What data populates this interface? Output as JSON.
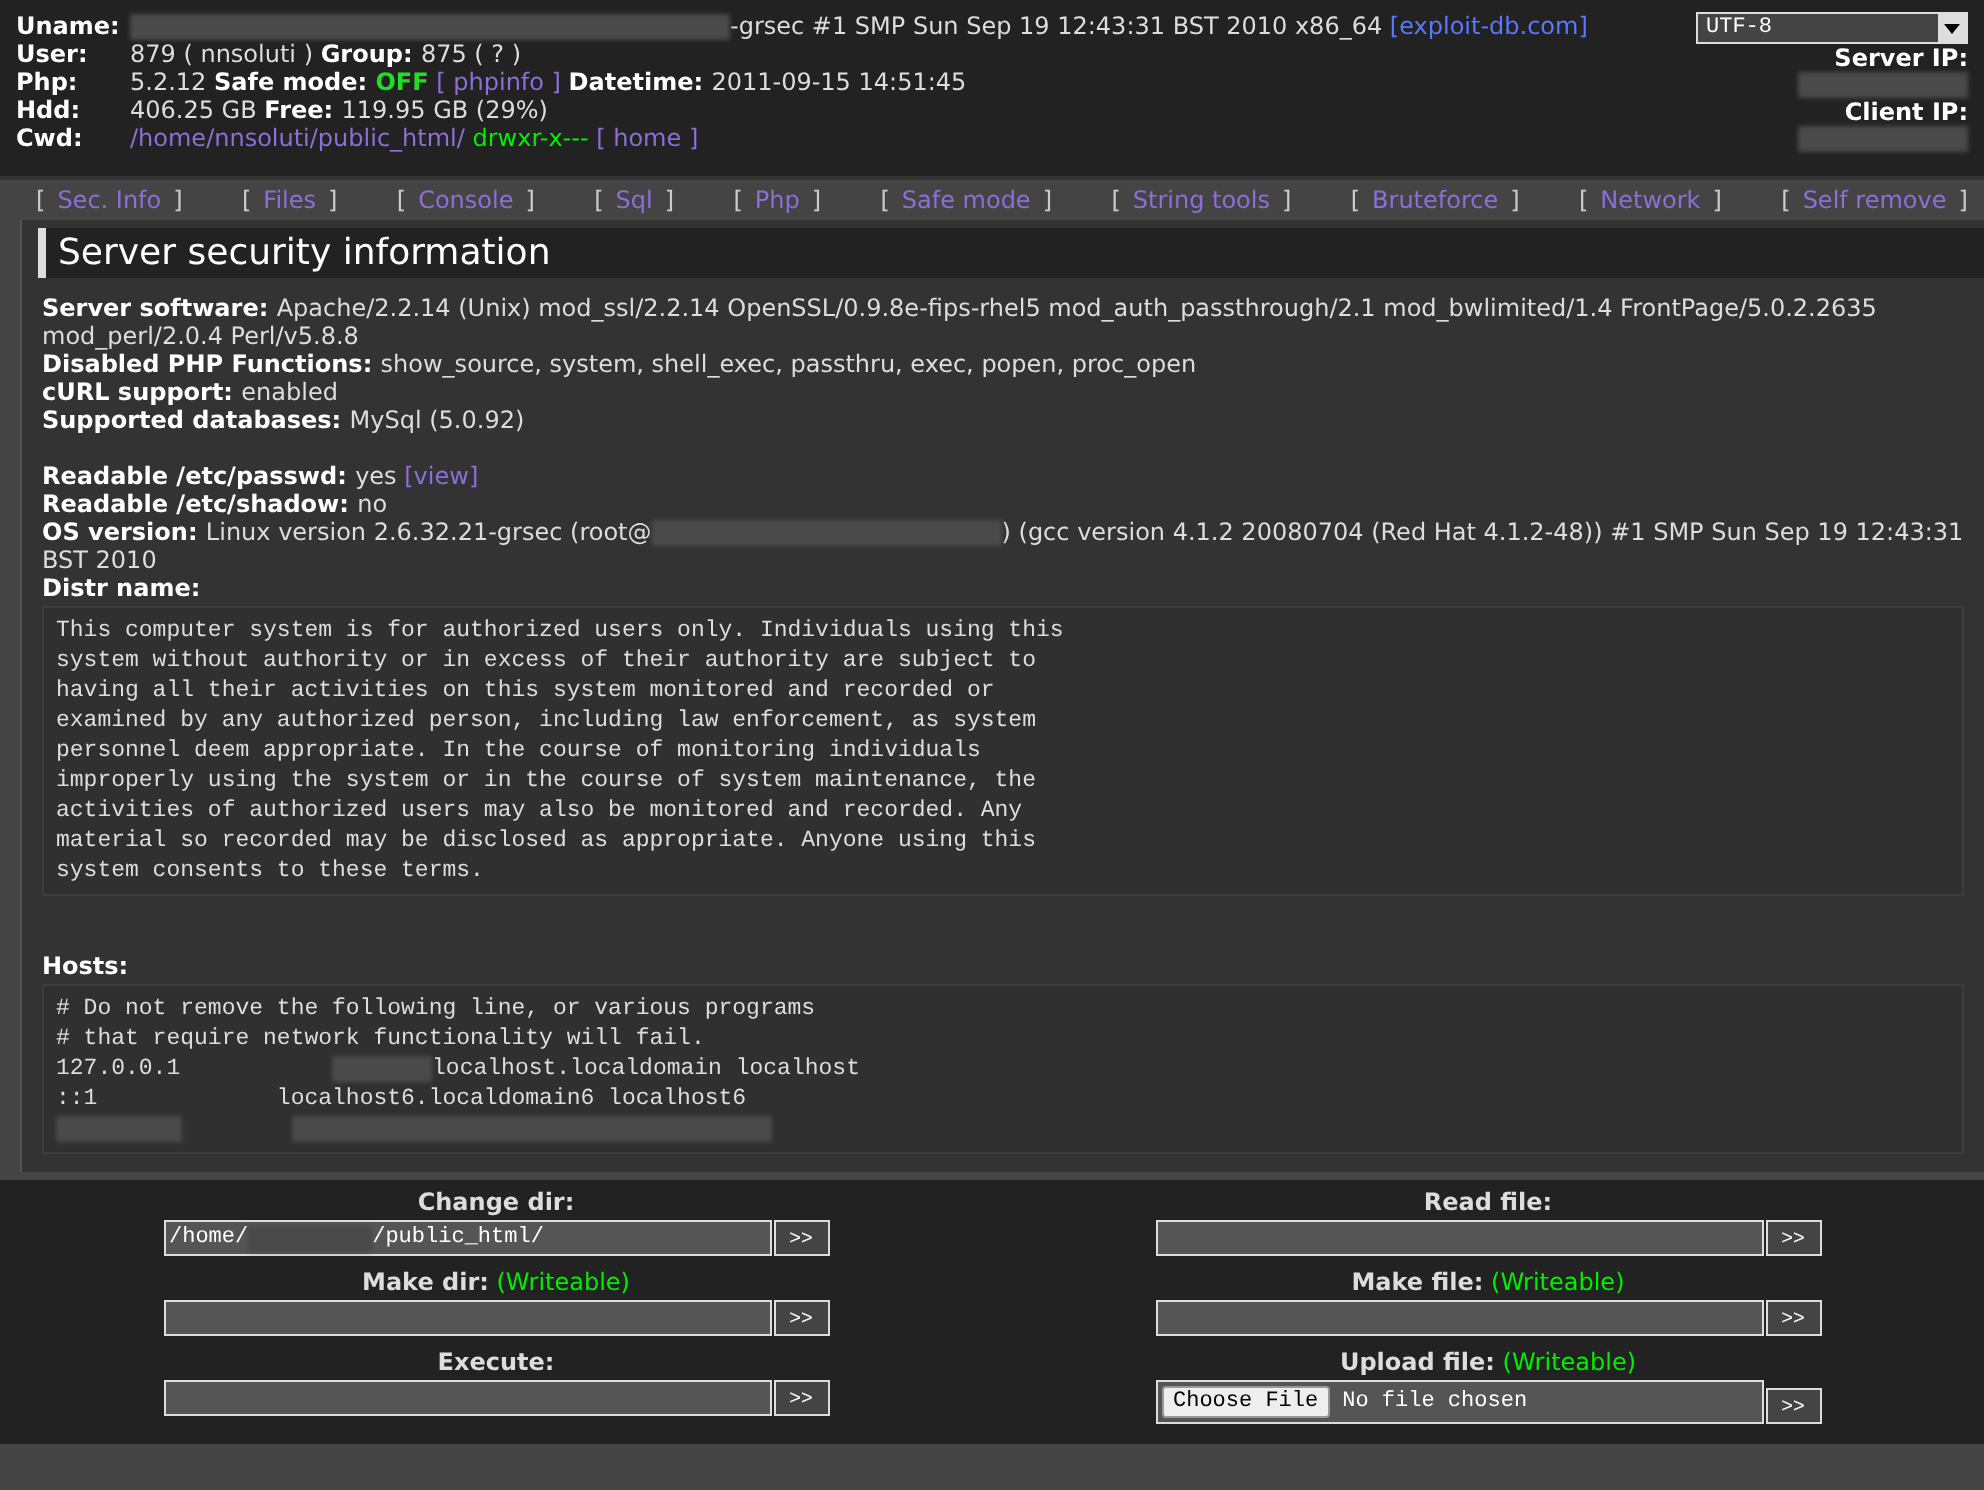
{
  "header": {
    "rows": [
      {
        "label": "Uname:",
        "parts": [
          {
            "kind": "redacted"
          },
          {
            "kind": "text",
            "text": "-grsec #1 SMP Sun Sep 19 12:43:31 BST 2010 x86_64 "
          },
          {
            "kind": "blue_link",
            "text": "[exploit-db.com]"
          }
        ]
      },
      {
        "label": "User:",
        "parts": [
          {
            "kind": "text",
            "text": "879 ( nnsoluti ) "
          },
          {
            "kind": "bold",
            "text": "Group: "
          },
          {
            "kind": "text",
            "text": "875 ( ? )"
          }
        ]
      },
      {
        "label": "Php:",
        "parts": [
          {
            "kind": "text",
            "text": "5.2.12 "
          },
          {
            "kind": "bold",
            "text": "Safe mode: "
          },
          {
            "kind": "green_bold",
            "text": "OFF"
          },
          {
            "kind": "link",
            "text": " [ phpinfo ] "
          },
          {
            "kind": "bold",
            "text": "Datetime: "
          },
          {
            "kind": "text",
            "text": "2011-09-15 14:51:45"
          }
        ]
      },
      {
        "label": "Hdd:",
        "parts": [
          {
            "kind": "text",
            "text": "406.25 GB "
          },
          {
            "kind": "bold",
            "text": "Free: "
          },
          {
            "kind": "text",
            "text": "119.95 GB (29%)"
          }
        ]
      },
      {
        "label": "Cwd:",
        "parts": [
          {
            "kind": "link",
            "text": "/home/nnsoluti/public_html/ "
          },
          {
            "kind": "green",
            "text": "drwxr-x---"
          },
          {
            "kind": "link",
            "text": " [ home ]"
          }
        ]
      }
    ],
    "charset": "UTF-8",
    "server_ip_label": "Server IP:",
    "client_ip_label": "Client IP:"
  },
  "nav": [
    {
      "label": "Sec. Info"
    },
    {
      "label": "Files"
    },
    {
      "label": "Console"
    },
    {
      "label": "Sql"
    },
    {
      "label": "Php"
    },
    {
      "label": "Safe mode"
    },
    {
      "label": "String tools"
    },
    {
      "label": "Bruteforce"
    },
    {
      "label": "Network"
    },
    {
      "label": "Self remove"
    }
  ],
  "nav_open": "[",
  "nav_close": "]",
  "section_title": "Server security information",
  "info_groups": [
    [
      {
        "parts": [
          {
            "kind": "bold",
            "text": "Server software: "
          },
          {
            "kind": "text",
            "text": "Apache/2.2.14 (Unix) mod_ssl/2.2.14 OpenSSL/0.9.8e-fips-rhel5 mod_auth_passthrough/2.1 mod_bwlimited/1.4 FrontPage/5.0.2.2635 mod_perl/2.0.4 Perl/v5.8.8"
          }
        ]
      },
      {
        "parts": [
          {
            "kind": "bold",
            "text": "Disabled PHP Functions: "
          },
          {
            "kind": "text",
            "text": "show_source, system, shell_exec, passthru, exec, popen, proc_open"
          }
        ]
      },
      {
        "parts": [
          {
            "kind": "bold",
            "text": "cURL support: "
          },
          {
            "kind": "text",
            "text": "enabled"
          }
        ]
      },
      {
        "parts": [
          {
            "kind": "bold",
            "text": "Supported databases: "
          },
          {
            "kind": "text",
            "text": "MySql (5.0.92)"
          }
        ]
      }
    ],
    [
      {
        "parts": [
          {
            "kind": "bold",
            "text": "Readable /etc/passwd: "
          },
          {
            "kind": "text",
            "text": "yes "
          },
          {
            "kind": "link",
            "text": "[view]"
          }
        ]
      },
      {
        "parts": [
          {
            "kind": "bold",
            "text": "Readable /etc/shadow: "
          },
          {
            "kind": "text",
            "text": "no"
          }
        ]
      },
      {
        "parts": [
          {
            "kind": "bold",
            "text": "OS version: "
          },
          {
            "kind": "text",
            "text": "Linux version 2.6.32.21-grsec (root@"
          },
          {
            "kind": "redacted"
          },
          {
            "kind": "text",
            "text": ") (gcc version 4.1.2 20080704 (Red Hat 4.1.2-48)) #1 SMP Sun Sep 19 12:43:31 BST 2010"
          }
        ]
      },
      {
        "parts": [
          {
            "kind": "bold",
            "text": "Distr name:"
          }
        ]
      }
    ]
  ],
  "distr_text": "This computer system is for authorized users only. Individuals using this\nsystem without authority or in excess of their authority are subject to\nhaving all their activities on this system monitored and recorded or\nexamined by any authorized person, including law enforcement, as system\npersonnel deem appropriate. In the course of monitoring individuals\nimproperly using the system or in the course of system maintenance, the\nactivities of authorized users may also be monitored and recorded. Any\nmaterial so recorded may be disclosed as appropriate. Anyone using this\nsystem consents to these terms.",
  "hosts_label": "Hosts:",
  "hosts": [
    {
      "parts": [
        {
          "kind": "text",
          "text": "# Do not remove the following line, or various programs"
        }
      ]
    },
    {
      "parts": [
        {
          "kind": "text",
          "text": "# that require network functionality will fail."
        }
      ]
    },
    {
      "parts": [
        {
          "kind": "text",
          "text": "127.0.0.1           "
        },
        {
          "kind": "redacted"
        },
        {
          "kind": "text",
          "text": "localhost.localdomain localhost"
        }
      ]
    },
    {
      "parts": [
        {
          "kind": "text",
          "text": "::1             localhost6.localdomain6 localhost6"
        }
      ]
    },
    {
      "parts": [
        {
          "kind": "redacted"
        },
        {
          "kind": "redacted"
        }
      ]
    }
  ],
  "forms": [
    [
      {
        "label": "Change dir:",
        "kind": "text",
        "value": [
          {
            "kind": "text",
            "text": "/home/"
          },
          {
            "kind": "redacted"
          },
          {
            "kind": "text",
            "text": "/public_html/"
          }
        ],
        "button": ">>"
      },
      {
        "label": "Make dir:",
        "note": "(Writeable)",
        "kind": "text",
        "button": ">>"
      },
      {
        "label": "Execute:",
        "kind": "text",
        "button": ">>"
      }
    ],
    [
      {
        "label": "Read file:",
        "kind": "text",
        "button": ">>"
      },
      {
        "label": "Make file:",
        "note": "(Writeable)",
        "kind": "text",
        "button": ">>"
      },
      {
        "label": "Upload file:",
        "note": "(Writeable)",
        "kind": "file",
        "file_button": "Choose File",
        "file_status": "No file chosen",
        "button": ">>"
      }
    ]
  ]
}
